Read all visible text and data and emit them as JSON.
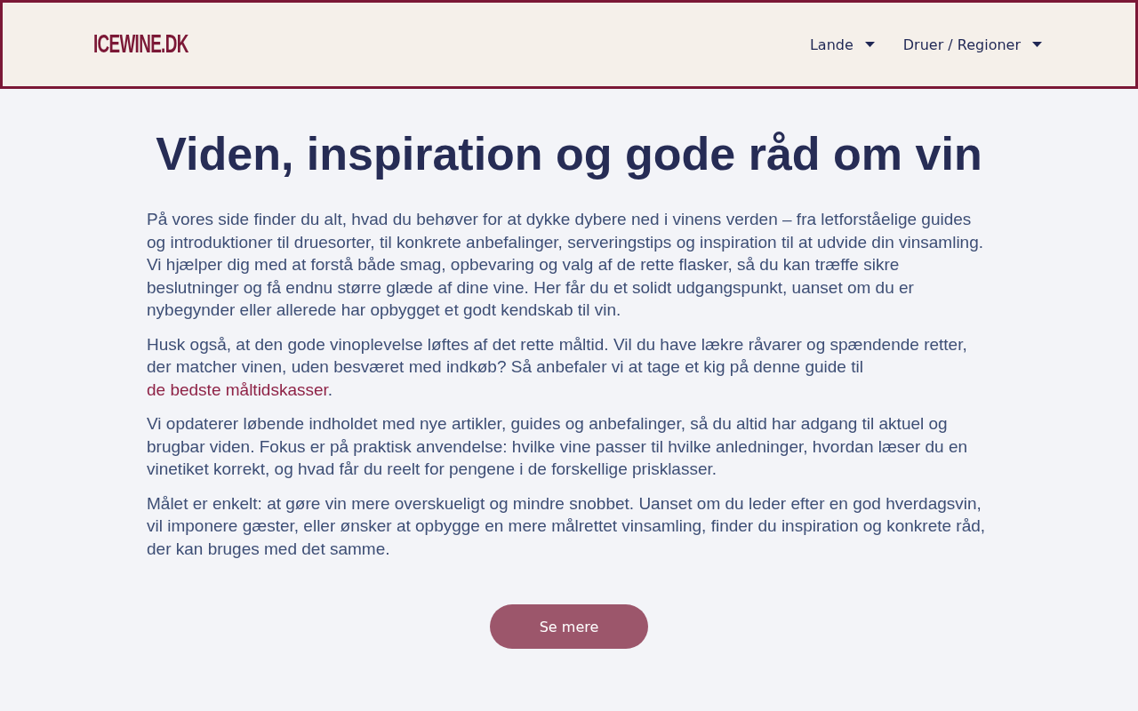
{
  "header": {
    "logo": "ICEWINE.DK",
    "nav": [
      {
        "label": "Lande",
        "has_dropdown": true
      },
      {
        "label": "Druer / Regioner",
        "has_dropdown": true
      }
    ]
  },
  "main": {
    "title": "Viden, inspiration og gode råd om vin",
    "paragraphs": [
      {
        "segments": [
          {
            "kind": "text",
            "text": "På vores side finder du alt, hvad du behøver for at dykke dybere ned i vinens verden – fra letforståelige guides og introduktioner til druesorter, til konkrete anbefalinger, serveringstips og inspiration til at udvide din vinsamling. Vi hjælper dig med at forstå både smag, opbevaring og valg af de rette flasker, så du kan træffe sikre beslutninger og få endnu større glæde af dine vine. Her får du et solidt udgangspunkt, uanset om du er nybegynder eller allerede har opbygget et godt kendskab til vin."
          }
        ]
      },
      {
        "segments": [
          {
            "kind": "text",
            "text": "Husk også, at den gode vinoplevelse løftes af det rette måltid. Vil du have lækre råvarer og spændende retter, der matcher vinen, uden besværet med indkøb? Så anbefaler vi at tage et kig på denne guide til "
          },
          {
            "kind": "link",
            "text": "de bedste måltidskasser"
          },
          {
            "kind": "text",
            "text": "."
          }
        ]
      },
      {
        "segments": [
          {
            "kind": "text",
            "text": "Vi opdaterer løbende indholdet med nye artikler, guides og anbefalinger, så du altid har adgang til aktuel og brugbar viden. Fokus er på praktisk anvendelse: hvilke vine passer til hvilke anledninger, hvordan læser du en vinetiket korrekt, og hvad får du reelt for pengene i de forskellige prisklasser."
          }
        ]
      },
      {
        "segments": [
          {
            "kind": "text",
            "text": "Målet er enkelt: at gøre vin mere overskueligt og mindre snobbet. Uanset om du leder efter en god hverdagsvin, vil imponere gæster, eller ønsker at opbygge en mere målrettet vinsamling, finder du inspiration og konkrete råd, der kan bruges med det samme."
          }
        ]
      }
    ],
    "button": "Se mere"
  }
}
